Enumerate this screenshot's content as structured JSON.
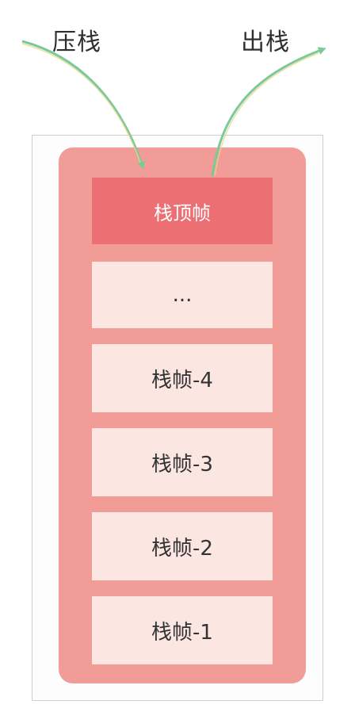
{
  "labels": {
    "push": "压栈",
    "pop": "出栈"
  },
  "stack": {
    "frames": [
      {
        "label": "栈顶帧"
      },
      {
        "label": "..."
      },
      {
        "label": "栈帧-4"
      },
      {
        "label": "栈帧-3"
      },
      {
        "label": "栈帧-2"
      },
      {
        "label": "栈帧-1"
      }
    ]
  },
  "colors": {
    "stack_container": "#f29c98",
    "top_frame": "#ec6f74",
    "frame": "#fbe6e1",
    "arrow": "#7bc89a"
  }
}
